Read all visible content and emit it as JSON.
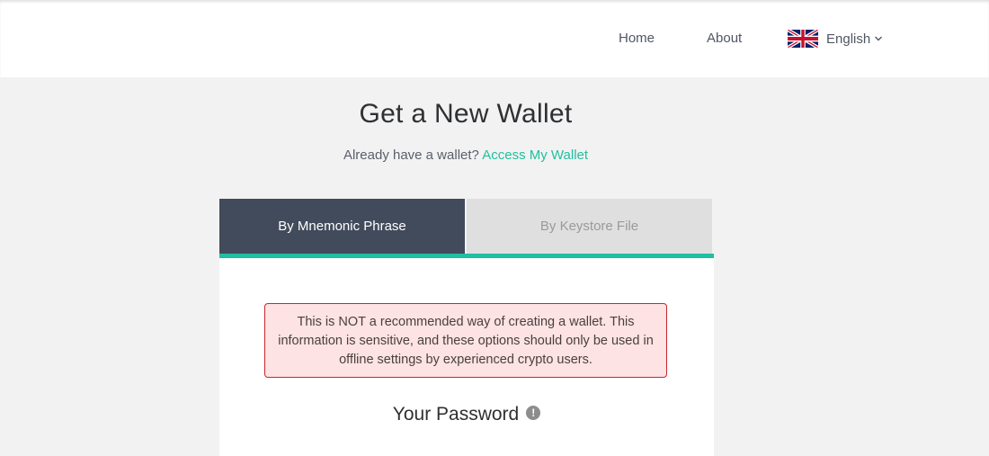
{
  "nav": {
    "home": "Home",
    "about": "About",
    "language": {
      "label": "English",
      "flag_icon": "uk-flag-icon"
    }
  },
  "page": {
    "title": "Get a New Wallet",
    "subtitle_prefix": "Already have a wallet?",
    "subtitle_link": "Access My Wallet"
  },
  "tabs": [
    {
      "label": "By Mnemonic Phrase",
      "active": true
    },
    {
      "label": "By Keystore File",
      "active": false
    }
  ],
  "warning": {
    "text": "This is NOT a recommended way of creating a wallet. This information is sensitive, and these options should only be used in offline settings by experienced crypto users."
  },
  "password": {
    "label": "Your Password",
    "info_icon": "!"
  },
  "colors": {
    "accent": "#1fbfa3",
    "tab_active_bg": "#424b5b",
    "warning_border": "#c8252d",
    "warning_bg": "#fde3e3"
  }
}
